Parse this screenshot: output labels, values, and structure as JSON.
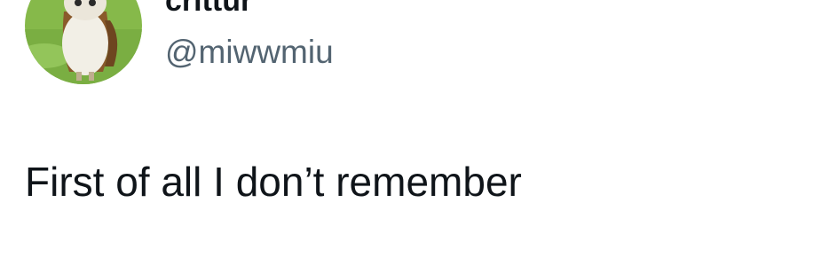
{
  "tweet": {
    "author": {
      "display_name": "crittur",
      "handle": "@miwwmiu",
      "avatar_icon": "owl-avatar-icon"
    },
    "text": "First of all I don’t remember"
  },
  "colors": {
    "primary_text": "#0f1419",
    "secondary_text": "#536471",
    "background": "#ffffff"
  }
}
